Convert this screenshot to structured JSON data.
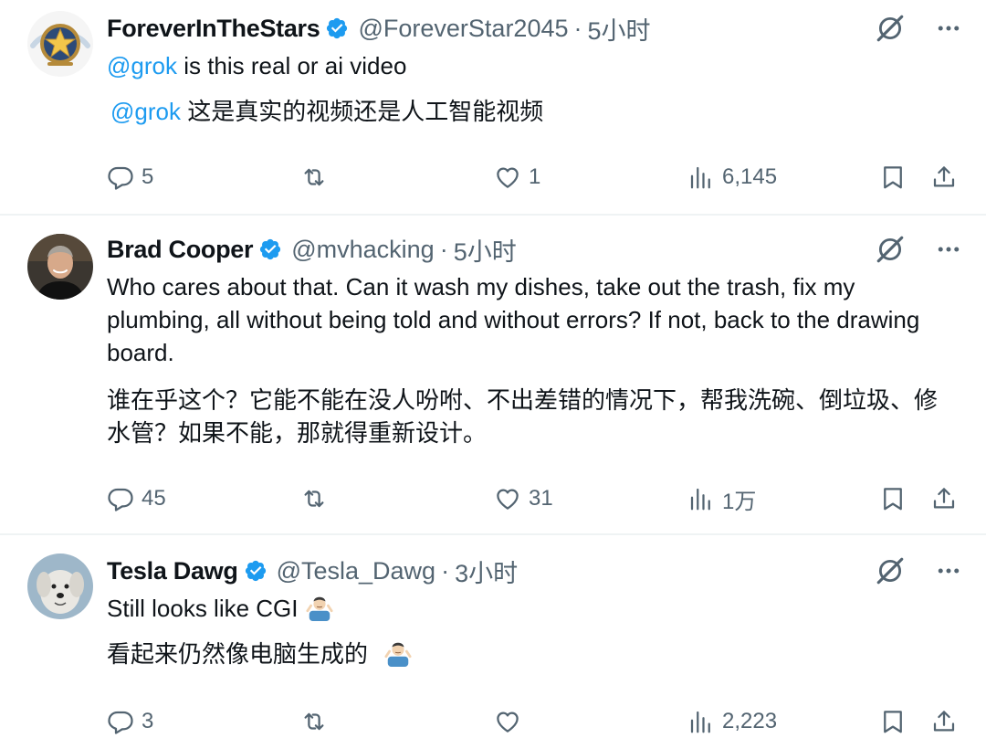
{
  "tweets": [
    {
      "author_name": "ForeverInTheStars",
      "handle": "@ForeverStar2045",
      "separator": "·",
      "time": "5小时",
      "mention": "@grok",
      "text_rest": " is this real or ai video",
      "translation_mention": "@grok",
      "translation_rest": " 这是真实的视频还是人工智能视频",
      "replies": "5",
      "reposts": "",
      "likes": "1",
      "views": "6,145"
    },
    {
      "author_name": "Brad Cooper",
      "handle": "@mvhacking",
      "separator": "·",
      "time": "5小时",
      "text": "Who cares about that. Can it wash my dishes, take out the trash, fix my plumbing, all without being told and without errors?  If not, back to the drawing board.",
      "translation": "谁在乎这个？它能不能在没人吩咐、不出差错的情况下，帮我洗碗、倒垃圾、修水管？如果不能，那就得重新设计。",
      "replies": "45",
      "reposts": "",
      "likes": "31",
      "views": "1万"
    },
    {
      "author_name": "Tesla Dawg",
      "handle": "@Tesla_Dawg",
      "separator": "·",
      "time": "3小时",
      "text": "Still looks like CGI",
      "translation": "看起来仍然像电脑生成的",
      "emoji": "man-shrugging-emoji",
      "replies": "3",
      "reposts": "",
      "likes": "",
      "views": "2,223"
    }
  ],
  "icons": {
    "reply": "reply-icon",
    "repost": "repost-icon",
    "like": "like-icon",
    "views": "views-icon",
    "bookmark": "bookmark-icon",
    "share": "share-icon",
    "grok": "grok-icon",
    "more": "more-icon",
    "verified": "verified-badge-icon"
  },
  "colors": {
    "accent": "#1d9bf0",
    "secondary_text": "#536471",
    "divider": "#eff3f4"
  }
}
